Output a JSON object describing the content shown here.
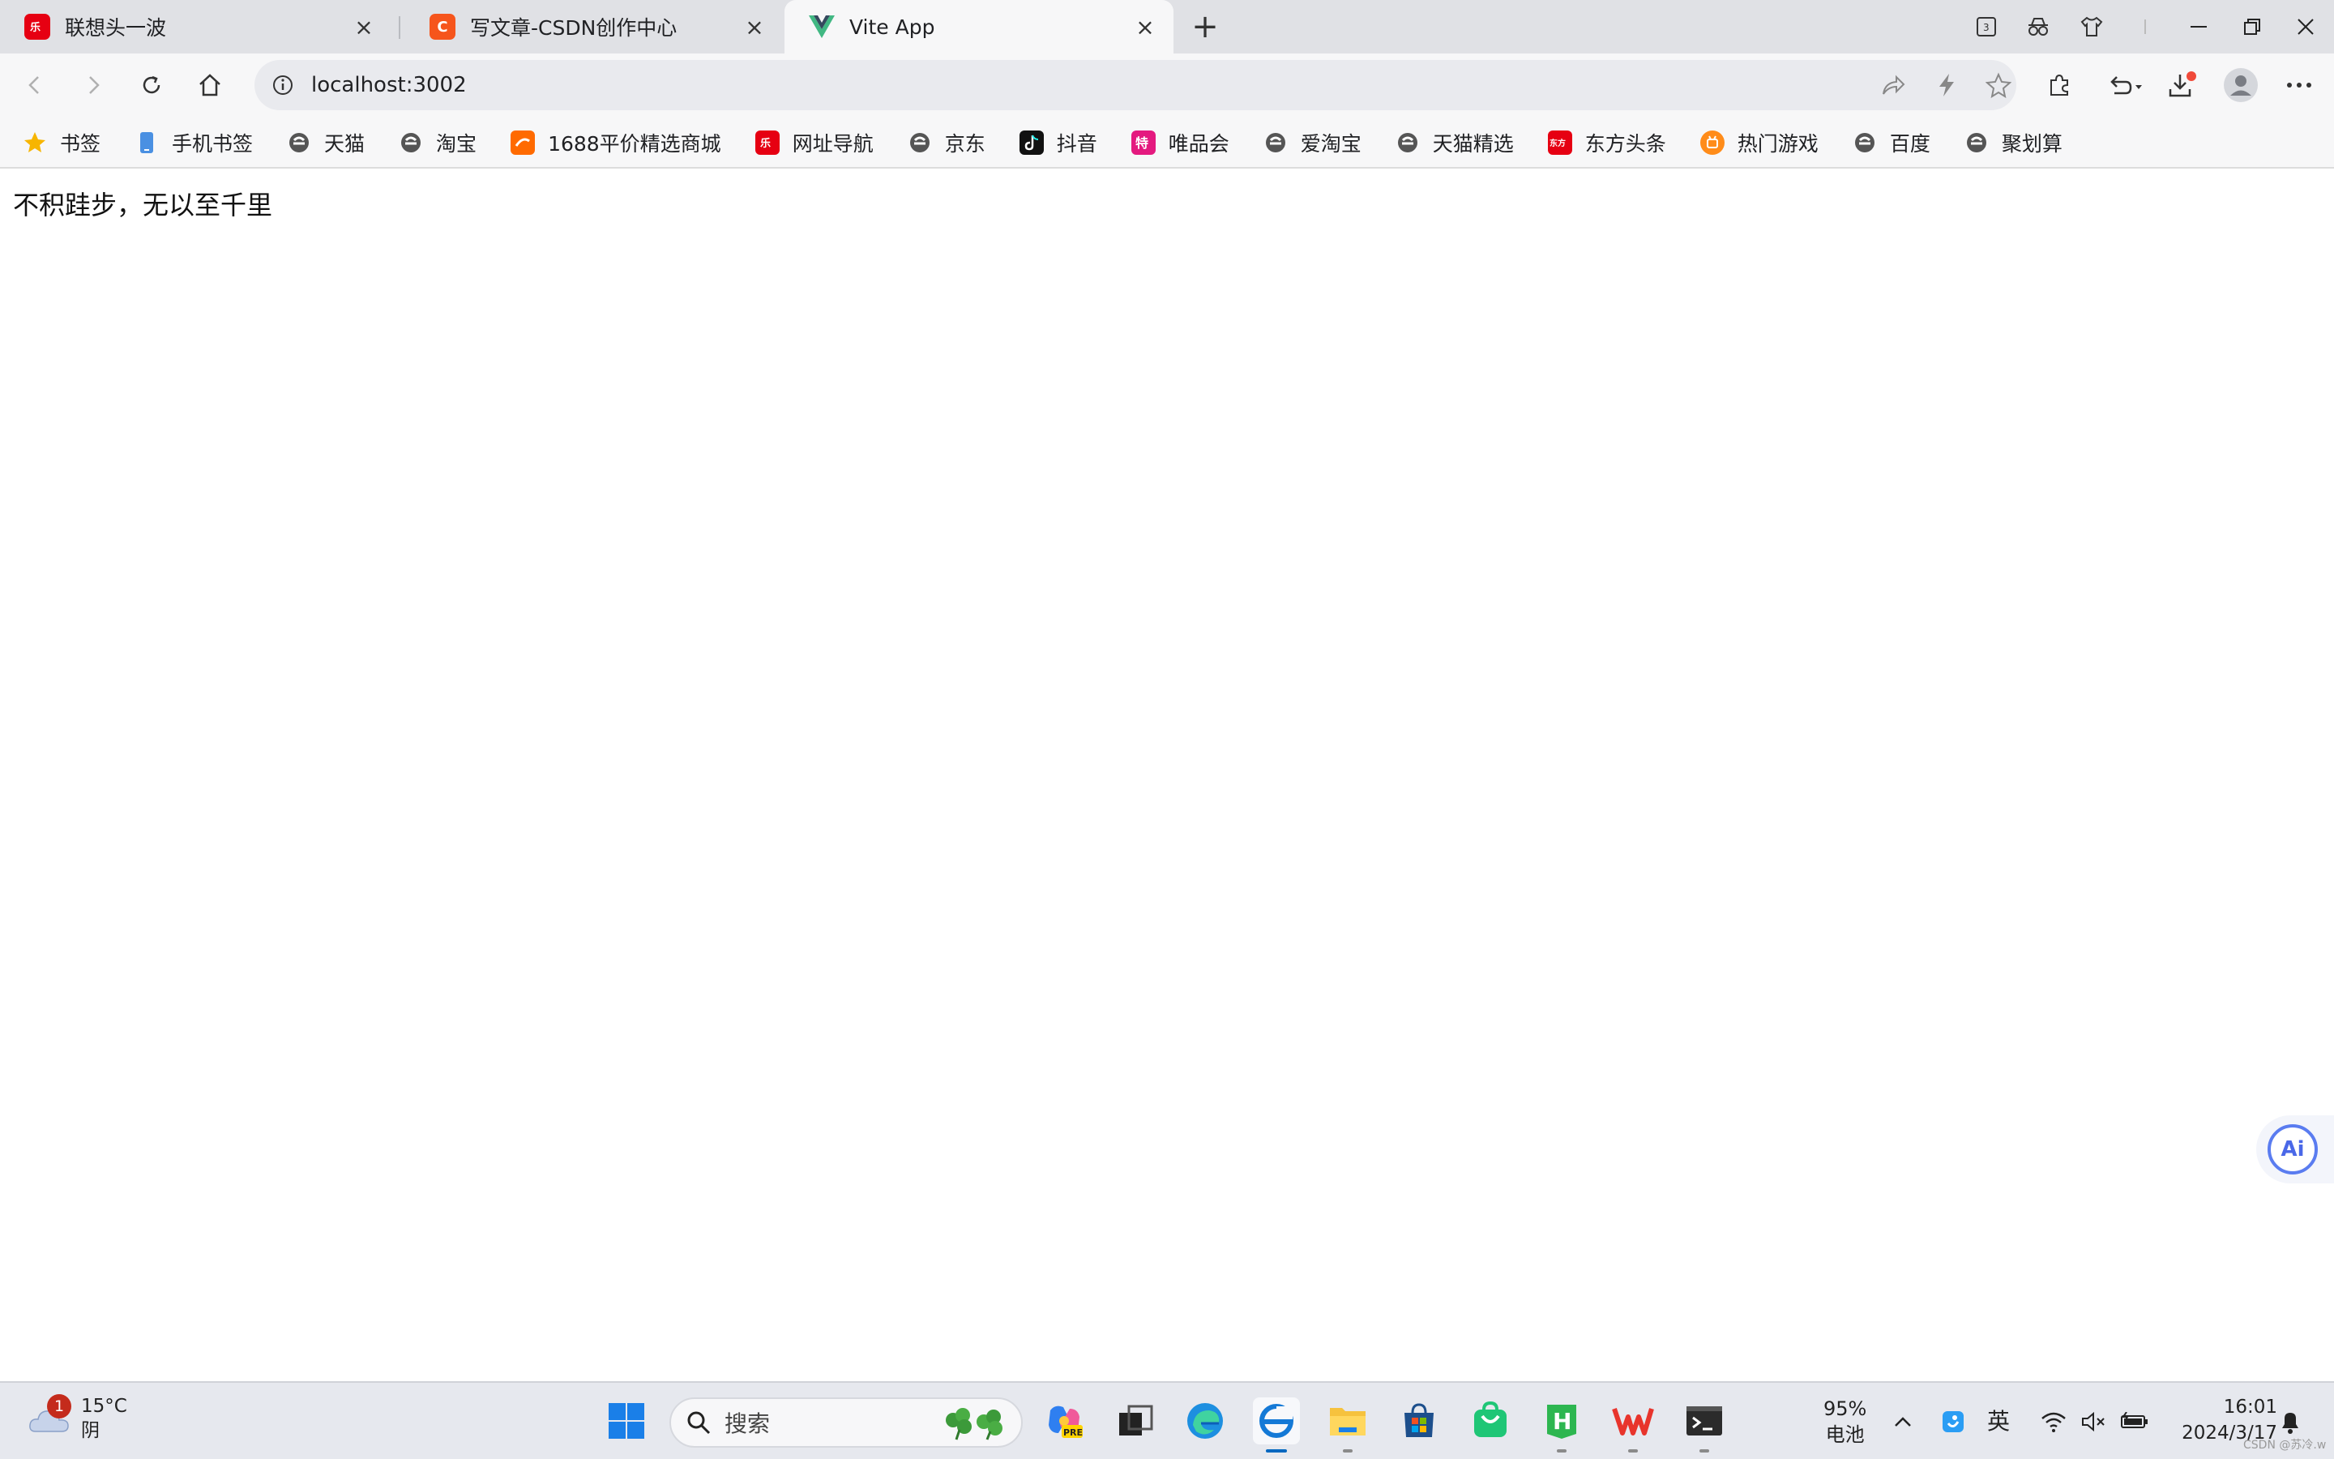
{
  "tabs": [
    {
      "title": "联想头一波",
      "icon": "lenovo-icon",
      "color": "#e60012"
    },
    {
      "title": "写文章-CSDN创作中心",
      "icon": "csdn-icon",
      "color": "#f6551c"
    },
    {
      "title": "Vite App",
      "icon": "vue-icon",
      "color": "#41b883"
    }
  ],
  "tab_strip": {
    "new_tab": "+",
    "tab_count": "3"
  },
  "address_bar": {
    "url": "localhost:3002"
  },
  "bookmarks": [
    {
      "label": "书签",
      "icon": "star-icon",
      "color": "#f7b500"
    },
    {
      "label": "手机书签",
      "icon": "phone-icon",
      "color": "#4a90e2"
    },
    {
      "label": "天猫",
      "icon": "ie-icon",
      "color": "#555555"
    },
    {
      "label": "淘宝",
      "icon": "ie-icon",
      "color": "#555555"
    },
    {
      "label": "1688平价精选商城",
      "icon": "1688-icon",
      "color": "#ff6a00"
    },
    {
      "label": "网址导航",
      "icon": "lenovo-icon",
      "color": "#e60012"
    },
    {
      "label": "京东",
      "icon": "ie-icon",
      "color": "#555555"
    },
    {
      "label": "抖音",
      "icon": "tiktok-icon",
      "color": "#111111"
    },
    {
      "label": "唯品会",
      "icon": "vip-icon",
      "color": "#e4197f"
    },
    {
      "label": "爱淘宝",
      "icon": "ie-icon",
      "color": "#555555"
    },
    {
      "label": "天猫精选",
      "icon": "ie-icon",
      "color": "#555555"
    },
    {
      "label": "东方头条",
      "icon": "dftt-icon",
      "color": "#e60012"
    },
    {
      "label": "热门游戏",
      "icon": "game-icon",
      "color": "#ff8c1a"
    },
    {
      "label": "百度",
      "icon": "ie-icon",
      "color": "#555555"
    },
    {
      "label": "聚划算",
      "icon": "ie-icon",
      "color": "#555555"
    }
  ],
  "page": {
    "content_text": "不积跬步，无以至千里"
  },
  "ai_button": {
    "label": "Ai"
  },
  "taskbar": {
    "weather": {
      "temp": "15°C",
      "condition": "阴",
      "badge": "1"
    },
    "search_placeholder": "搜索",
    "battery": {
      "percent": "95%",
      "label": "电池"
    },
    "ime": "英",
    "clock": {
      "time": "16:01",
      "date": "2024/3/17"
    }
  },
  "watermark": "CSDN @苏冷.w",
  "colors": {
    "accent": "#0067c0",
    "tab_bg": "#e0e1e5",
    "toolbar_bg": "#f7f7f8"
  }
}
